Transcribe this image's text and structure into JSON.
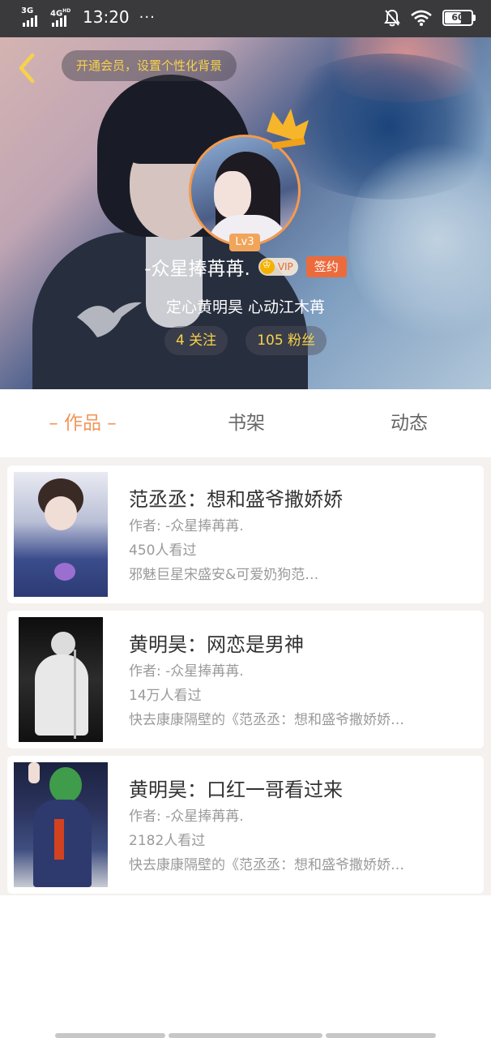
{
  "status_bar": {
    "network1": "3G",
    "network2": "4G",
    "network2_sup": "HD",
    "time": "13:20",
    "more": "···",
    "battery": "60"
  },
  "header": {
    "vip_tip": "开通会员，设置个性化背景",
    "level": "Lv3",
    "username": "-众星捧苒苒.",
    "vip_label": "VIP",
    "sign_label": "签约",
    "bio": "定心黄明昊 心动江木苒",
    "following": "4 关注",
    "followers": "105 粉丝",
    "colors": {
      "gold": "#f7d24a",
      "avatar_ring": "#f39a4e",
      "sign": "#ec6b3d"
    }
  },
  "tabs": [
    {
      "label": "– 作品 –",
      "active": true
    },
    {
      "label": "书架",
      "active": false
    },
    {
      "label": "动态",
      "active": false
    }
  ],
  "works": [
    {
      "title": "范丞丞：想和盛爷撒娇娇",
      "author": "作者: -众星捧苒苒.",
      "views": "450人看过",
      "desc": "邪魅巨星宋盛安&可爱奶狗范…"
    },
    {
      "title": "黄明昊：网恋是男神",
      "author": "作者: -众星捧苒苒.",
      "views": "14万人看过",
      "desc": "快去康康隔壁的《范丞丞：想和盛爷撒娇娇…"
    },
    {
      "title": "黄明昊：口红一哥看过来",
      "author": "作者: -众星捧苒苒.",
      "views": "2182人看过",
      "desc": "快去康康隔壁的《范丞丞：想和盛爷撒娇娇…"
    }
  ],
  "icons": {
    "back": "back-arrow-icon",
    "crown": "crown-icon",
    "wifi": "wifi-icon",
    "mute": "mute-bell-icon",
    "battery": "battery-icon"
  }
}
